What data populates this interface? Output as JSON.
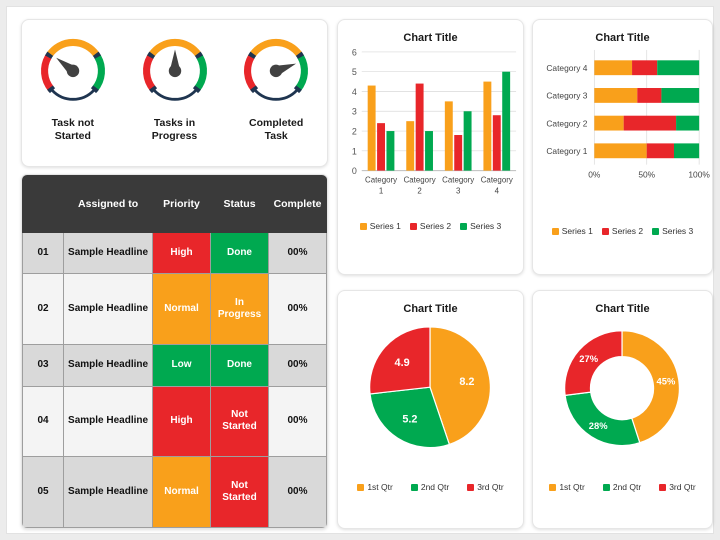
{
  "theme": {
    "orange": "#F9A01B",
    "red": "#E8262A",
    "green": "#00A950",
    "navy": "#1F3550",
    "needle": "#414141",
    "header_bg": "#3A3A3A",
    "row_alt_bg": "#D9D9D9",
    "row_plain_bg": "#F4F4F4",
    "page_bg": "#ECECEC"
  },
  "gauges": {
    "items": [
      {
        "label": "Task not Started",
        "needle_angle": -52,
        "icon": "gauge-icon"
      },
      {
        "label": "Tasks in Progress",
        "needle_angle": 0,
        "icon": "gauge-icon"
      },
      {
        "label": "Completed Task",
        "needle_angle": 70,
        "icon": "gauge-icon"
      }
    ]
  },
  "table": {
    "headers": [
      "",
      "Assigned to",
      "Priority",
      "Status",
      "Complete"
    ],
    "rows": [
      {
        "idx": "01",
        "name": "Sample Headline",
        "priority": "High",
        "priority_color": "red",
        "status": "Done",
        "status_color": "green",
        "complete": "00%"
      },
      {
        "idx": "02",
        "name": "Sample Headline",
        "priority": "Normal",
        "priority_color": "orange",
        "status": "In Progress",
        "status_color": "orange",
        "complete": "00%"
      },
      {
        "idx": "03",
        "name": "Sample Headline",
        "priority": "Low",
        "priority_color": "green",
        "status": "Done",
        "status_color": "green",
        "complete": "00%"
      },
      {
        "idx": "04",
        "name": "Sample Headline",
        "priority": "High",
        "priority_color": "red",
        "status": "Not Started",
        "status_color": "red",
        "complete": "00%"
      },
      {
        "idx": "05",
        "name": "Sample Headline",
        "priority": "Normal",
        "priority_color": "orange",
        "status": "Not Started",
        "status_color": "red",
        "complete": "00%"
      }
    ]
  },
  "chart_data": [
    {
      "id": "bar",
      "type": "bar",
      "title": "Chart Title",
      "categories": [
        "Category 1",
        "Category 2",
        "Category 3",
        "Category 4"
      ],
      "series": [
        {
          "name": "Series 1",
          "color": "#F9A01B",
          "values": [
            4.3,
            2.5,
            3.5,
            4.5
          ]
        },
        {
          "name": "Series 2",
          "color": "#E8262A",
          "values": [
            2.4,
            4.4,
            1.8,
            2.8
          ]
        },
        {
          "name": "Series 3",
          "color": "#00A950",
          "values": [
            2.0,
            2.0,
            3.0,
            5.0
          ]
        }
      ],
      "xlabel": "",
      "ylabel": "",
      "ylim": [
        0,
        6
      ],
      "yticks": [
        0,
        1,
        2,
        3,
        4,
        5,
        6
      ],
      "grid": true,
      "legend_position": "bottom"
    },
    {
      "id": "stacked",
      "type": "bar",
      "orientation": "horizontal",
      "stacked": "100%",
      "title": "Chart Title",
      "categories": [
        "Category 1",
        "Category 2",
        "Category 3",
        "Category 4"
      ],
      "series": [
        {
          "name": "Series 1",
          "color": "#F9A01B",
          "values": [
            50,
            28,
            41,
            36
          ]
        },
        {
          "name": "Series 2",
          "color": "#E8262A",
          "values": [
            26,
            50,
            23,
            24
          ]
        },
        {
          "name": "Series 3",
          "color": "#00A950",
          "values": [
            24,
            22,
            36,
            40
          ]
        }
      ],
      "xticks": [
        "0%",
        "50%",
        "100%"
      ],
      "xlim": [
        0,
        100
      ],
      "grid": true,
      "legend_position": "bottom"
    },
    {
      "id": "pie",
      "type": "pie",
      "title": "Chart Title",
      "labels": [
        "1st Qtr",
        "2nd Qtr",
        "3rd Qtr"
      ],
      "values": [
        8.2,
        5.2,
        4.9
      ],
      "data_labels": [
        "8.2",
        "5.2",
        "4.9"
      ],
      "colors": [
        "#F9A01B",
        "#00A950",
        "#E8262A"
      ],
      "legend_position": "bottom"
    },
    {
      "id": "donut",
      "type": "pie",
      "hole": 0.55,
      "title": "Chart Title",
      "labels": [
        "1st Qtr",
        "2nd Qtr",
        "3rd Qtr"
      ],
      "values": [
        45,
        28,
        27
      ],
      "data_labels": [
        "45%",
        "28%",
        "27%"
      ],
      "colors": [
        "#F9A01B",
        "#00A950",
        "#E8262A"
      ],
      "legend_position": "bottom"
    }
  ]
}
